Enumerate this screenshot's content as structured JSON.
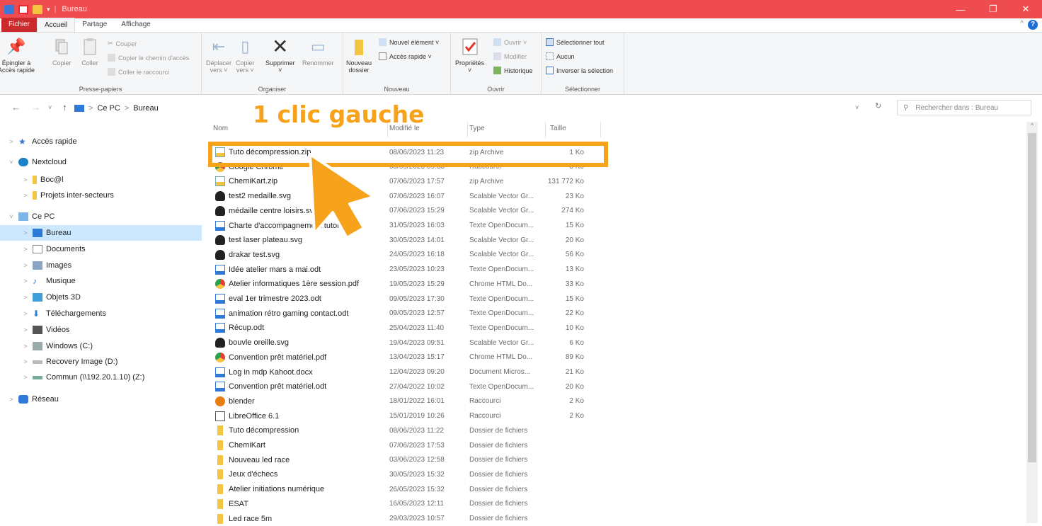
{
  "window": {
    "title": "Bureau",
    "title_color": "#ee4c4f"
  },
  "tabs": [
    "Fichier",
    "Accueil",
    "Partage",
    "Affichage"
  ],
  "ribbon": {
    "presse_papiers": {
      "label": "Presse-papiers",
      "pin": "Épingler à\nAccès rapide",
      "copy": "Copier",
      "paste": "Coller",
      "cut": "Couper",
      "copy_path": "Copier le chemin d'accès",
      "paste_shortcut": "Coller le raccourci"
    },
    "organiser": {
      "label": "Organiser",
      "move": "Déplacer\nvers ˅",
      "copy_to": "Copier\nvers ˅",
      "delete": "Supprimer\n˅",
      "rename": "Renommer"
    },
    "nouveau": {
      "label": "Nouveau",
      "new_folder": "Nouveau\ndossier",
      "new_item": "Nouvel élément ˅",
      "easy_access": "Accès rapide ˅"
    },
    "ouvrir": {
      "label": "Ouvrir",
      "properties": "Propriétés\n˅",
      "open": "Ouvrir ˅",
      "edit": "Modifier",
      "history": "Historique"
    },
    "selectionner": {
      "label": "Sélectionner",
      "select_all": "Sélectionner tout",
      "select_none": "Aucun",
      "invert": "Inverser la sélection"
    }
  },
  "address": {
    "root": "Ce PC",
    "folder": "Bureau",
    "search_placeholder": "Rechercher dans : Bureau"
  },
  "sidebar": [
    {
      "label": "Accès rapide",
      "icon": "star-icon",
      "chev": ">"
    },
    {
      "label": "Nextcloud",
      "icon": "nextcloud-icon",
      "chev": "˅"
    },
    {
      "label": "Boc@l",
      "icon": "folder-icon",
      "chev": ">"
    },
    {
      "label": "Projets inter-secteurs",
      "icon": "folder-icon",
      "chev": ">"
    },
    {
      "label": "Ce PC",
      "icon": "pc-icon",
      "chev": "˅"
    },
    {
      "label": "Bureau",
      "icon": "desktop-icon",
      "chev": ">"
    },
    {
      "label": "Documents",
      "icon": "documents-icon",
      "chev": ">"
    },
    {
      "label": "Images",
      "icon": "images-icon",
      "chev": ">"
    },
    {
      "label": "Musique",
      "icon": "music-icon",
      "chev": ">"
    },
    {
      "label": "Objets 3D",
      "icon": "cube-icon",
      "chev": ">"
    },
    {
      "label": "Téléchargements",
      "icon": "download-icon",
      "chev": ">"
    },
    {
      "label": "Vidéos",
      "icon": "video-icon",
      "chev": ">"
    },
    {
      "label": "Windows (C:)",
      "icon": "drive-icon",
      "chev": ">"
    },
    {
      "label": "Recovery Image (D:)",
      "icon": "drive-icon",
      "chev": ">"
    },
    {
      "label": "Commun (\\\\192.20.1.10) (Z:)",
      "icon": "network-drive-icon",
      "chev": ">"
    },
    {
      "label": "Réseau",
      "icon": "network-icon",
      "chev": ">"
    }
  ],
  "columns": {
    "name": "Nom",
    "modified": "Modifié le",
    "type": "Type",
    "size": "Taille"
  },
  "files": [
    {
      "name": "Tuto décompression.zip",
      "date": "08/06/2023 11:23",
      "type": "zip Archive",
      "size": "1 Ko",
      "icon": "zip-icon"
    },
    {
      "name": "Google Chrome",
      "date": "08/06/2023 09:33",
      "type": "Raccourci",
      "size": "3 Ko",
      "icon": "chrome-icon"
    },
    {
      "name": "ChemiKart.zip",
      "date": "07/06/2023 17:57",
      "type": "zip Archive",
      "size": "131 772 Ko",
      "icon": "zip-icon"
    },
    {
      "name": "test2 medaille.svg",
      "date": "07/06/2023 16:07",
      "type": "Scalable Vector Gr...",
      "size": "23 Ko",
      "icon": "inkscape-icon"
    },
    {
      "name": "médaille centre loisirs.svg",
      "date": "07/06/2023 15:29",
      "type": "Scalable Vector Gr...",
      "size": "274 Ko",
      "icon": "inkscape-icon"
    },
    {
      "name": "Charte d'accompagnement tutorat.odt",
      "date": "31/05/2023 16:03",
      "type": "Texte OpenDocum...",
      "size": "15 Ko",
      "icon": "odt-icon"
    },
    {
      "name": "test laser plateau.svg",
      "date": "30/05/2023 14:01",
      "type": "Scalable Vector Gr...",
      "size": "20 Ko",
      "icon": "inkscape-icon"
    },
    {
      "name": "drakar test.svg",
      "date": "24/05/2023 16:18",
      "type": "Scalable Vector Gr...",
      "size": "56 Ko",
      "icon": "inkscape-icon"
    },
    {
      "name": "Idée atelier mars a mai.odt",
      "date": "23/05/2023 10:23",
      "type": "Texte OpenDocum...",
      "size": "13 Ko",
      "icon": "odt-icon"
    },
    {
      "name": "Atelier informatiques 1ère session.pdf",
      "date": "19/05/2023 15:29",
      "type": "Chrome HTML Do...",
      "size": "33 Ko",
      "icon": "chrome-icon"
    },
    {
      "name": "eval 1er trimestre 2023.odt",
      "date": "09/05/2023 17:30",
      "type": "Texte OpenDocum...",
      "size": "15 Ko",
      "icon": "odt-icon"
    },
    {
      "name": "animation rétro gaming contact.odt",
      "date": "09/05/2023 12:57",
      "type": "Texte OpenDocum...",
      "size": "22 Ko",
      "icon": "odt-icon"
    },
    {
      "name": "Récup.odt",
      "date": "25/04/2023 11:40",
      "type": "Texte OpenDocum...",
      "size": "10 Ko",
      "icon": "odt-icon"
    },
    {
      "name": "bouvle oreille.svg",
      "date": "19/04/2023 09:51",
      "type": "Scalable Vector Gr...",
      "size": "6 Ko",
      "icon": "inkscape-icon"
    },
    {
      "name": "Convention prêt matériel.pdf",
      "date": "13/04/2023 15:17",
      "type": "Chrome HTML Do...",
      "size": "89 Ko",
      "icon": "chrome-icon"
    },
    {
      "name": "Log in mdp Kahoot.docx",
      "date": "12/04/2023 09:20",
      "type": "Document Micros...",
      "size": "21 Ko",
      "icon": "odt-icon"
    },
    {
      "name": "Convention prêt matériel.odt",
      "date": "27/04/2022 10:02",
      "type": "Texte OpenDocum...",
      "size": "20 Ko",
      "icon": "odt-icon"
    },
    {
      "name": "blender",
      "date": "18/01/2022 16:01",
      "type": "Raccourci",
      "size": "2 Ko",
      "icon": "blender-icon"
    },
    {
      "name": "LibreOffice 6.1",
      "date": "15/01/2019 10:26",
      "type": "Raccourci",
      "size": "2 Ko",
      "icon": "shortcut-icon"
    },
    {
      "name": "Tuto décompression",
      "date": "08/06/2023 11:22",
      "type": "Dossier de fichiers",
      "size": "",
      "icon": "folder-icon"
    },
    {
      "name": "ChemiKart",
      "date": "07/06/2023 17:53",
      "type": "Dossier de fichiers",
      "size": "",
      "icon": "folder-icon"
    },
    {
      "name": "Nouveau led race",
      "date": "03/06/2023 12:58",
      "type": "Dossier de fichiers",
      "size": "",
      "icon": "folder-icon"
    },
    {
      "name": "Jeux d'échecs",
      "date": "30/05/2023 15:32",
      "type": "Dossier de fichiers",
      "size": "",
      "icon": "folder-icon"
    },
    {
      "name": "Atelier initiations numérique",
      "date": "26/05/2023 15:32",
      "type": "Dossier de fichiers",
      "size": "",
      "icon": "folder-icon"
    },
    {
      "name": "ESAT",
      "date": "16/05/2023 12:11",
      "type": "Dossier de fichiers",
      "size": "",
      "icon": "folder-icon"
    },
    {
      "name": "Led race 5m",
      "date": "29/03/2023 10:57",
      "type": "Dossier de fichiers",
      "size": "",
      "icon": "folder-icon"
    }
  ],
  "annotation": {
    "text": "1 clic gauche",
    "color": "#f7a21b"
  }
}
